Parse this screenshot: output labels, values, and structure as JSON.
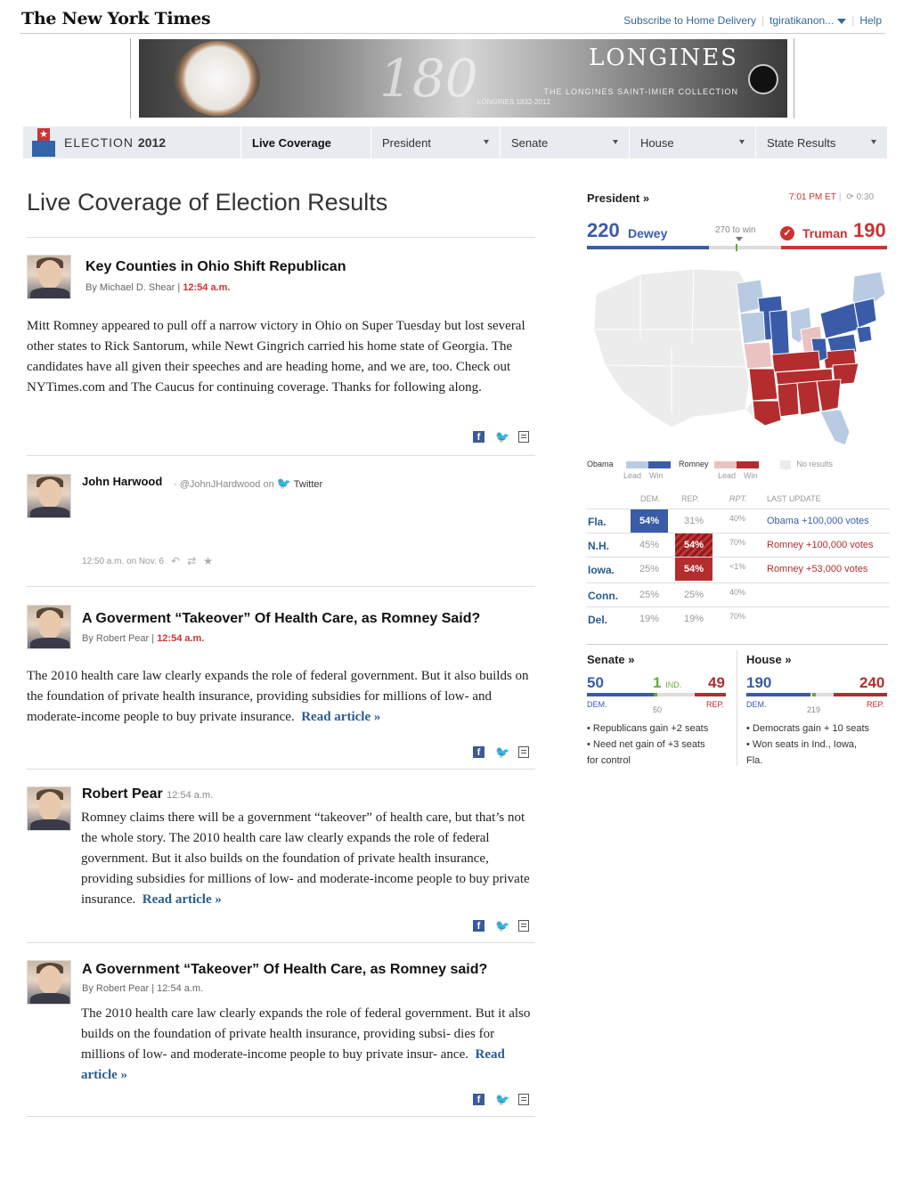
{
  "masthead": {
    "logo": "The New York Times",
    "subscribe": "Subscribe to Home Delivery",
    "user": "tgiratikanon...",
    "help": "Help"
  },
  "ad": {
    "number": "180",
    "brand": "LONGINES",
    "tagline": "THE LONGINES SAINT-IMIER COLLECTION",
    "subline": "LONGINES 1832-2012"
  },
  "nav": {
    "section_prefix": "ELECTION",
    "section_year": "2012",
    "tabs": [
      {
        "label": "Live Coverage"
      },
      {
        "label": "President"
      },
      {
        "label": "Senate"
      },
      {
        "label": "House"
      },
      {
        "label": "State Results"
      }
    ]
  },
  "page": {
    "title": "Live Coverage of Election Results"
  },
  "posts": [
    {
      "headline": "Key Counties in Ohio Shift Republican",
      "byline": "By Michael D. Shear",
      "time": "12:54 a.m.",
      "body": "Mitt Romney appeared to pull off a narrow victory in Ohio on Super Tuesday but lost several other states to Rick Santorum, while Newt Gingrich carried his home state of Georgia. The candidates have all given their speeches and are heading home, and we are, too. Check out NYTimes.com and The Caucus for continuing coverage. Thanks for following along."
    },
    {
      "headline": "A Goverment “Takeover” Of Health Care, as Romney Said?",
      "byline": "By Robert Pear",
      "time": "12:54 a.m.",
      "body": "The 2010 health care law clearly expands the role of federal government. But it also builds on the foundation of private health insurance, providing subsidies for millions of low- and moderate-income people to buy private insurance.",
      "read": "Read article »"
    },
    {
      "author": "Robert Pear",
      "time": "12:54 a.m.",
      "body": "Romney claims there will be a government “takeover” of health care, but that’s not the whole story.  The 2010 health care law clearly expands the role of federal government. But it also builds on the foundation of private health insurance, providing subsidies for millions of low- and moderate-income people to buy private insurance.",
      "read": "Read article »"
    },
    {
      "headline": "A Government “Takeover” Of Health Care, as Romney said?",
      "byline": "By Robert Pear | 12:54 a.m.",
      "body": "The 2010 health care law clearly expands the role of federal government. But it also builds on the foundation of private health insurance, providing subsi- dies for millions of low- and moderate-income people to buy private insur- ance.",
      "read": "Read article »"
    }
  ],
  "tweet": {
    "name": "John Harwood",
    "handle": "@JohnJHardwood on",
    "service": "Twitter",
    "meta": "12:50 a.m. on Nov. 6"
  },
  "president": {
    "link": "President »",
    "time": "7:01 PM ET",
    "timer": "0:30",
    "dem_count": "220",
    "dem_name": "Dewey",
    "to_win": "270 to win",
    "rep_name": "Truman",
    "rep_count": "190",
    "dem_fraction": 0.4074,
    "rep_fraction": 0.3519
  },
  "legend": {
    "obama": "Obama",
    "romney": "Romney",
    "lead": "Lead",
    "win": "Win",
    "no_results": "No results"
  },
  "results_table": {
    "headers": {
      "dem": "DEM.",
      "rep": "REP.",
      "rpt": "RPT.",
      "update": "LAST UPDATE"
    },
    "rows": [
      {
        "state": "Fla.",
        "dem": "54%",
        "rep": "31%",
        "rpt": "40%",
        "update": "Obama +100,000 votes",
        "winner": "dem"
      },
      {
        "state": "N.H.",
        "dem": "45%",
        "rep": "54%",
        "rpt": "70%",
        "update": "Romney +100,000 votes",
        "winner": "rep-hatch"
      },
      {
        "state": "Iowa.",
        "dem": "25%",
        "rep": "54%",
        "rpt": "<1%",
        "update": "Romney +53,000 votes",
        "winner": "rep"
      },
      {
        "state": "Conn.",
        "dem": "25%",
        "rep": "25%",
        "rpt": "40%",
        "update": "",
        "winner": "none"
      },
      {
        "state": "Del.",
        "dem": "19%",
        "rep": "19%",
        "rpt": "70%",
        "update": "",
        "winner": "none"
      }
    ]
  },
  "senate": {
    "link": "Senate »",
    "dem": "50",
    "ind": "1",
    "ind_label": "IND.",
    "rep": "49",
    "dem_label": "DEM.",
    "rep_label": "REP.",
    "mid": "50",
    "notes": [
      "• Republicans gain +2 seats",
      "• Need net gain of +3 seats",
      "for control"
    ]
  },
  "house": {
    "link": "House »",
    "dem": "190",
    "rep": "240",
    "dem_label": "DEM.",
    "rep_label": "REP.",
    "mid": "219",
    "notes": [
      "• Democrats gain + 10 seats",
      "• Won seats in Ind., Iowa,",
      "Fla."
    ]
  },
  "colors": {
    "dem": "#3a5ca8",
    "dem_lead": "#b8cbe3",
    "rep": "#b32d2e",
    "rep_lead": "#eac2c2",
    "link": "#2a5c8e"
  }
}
